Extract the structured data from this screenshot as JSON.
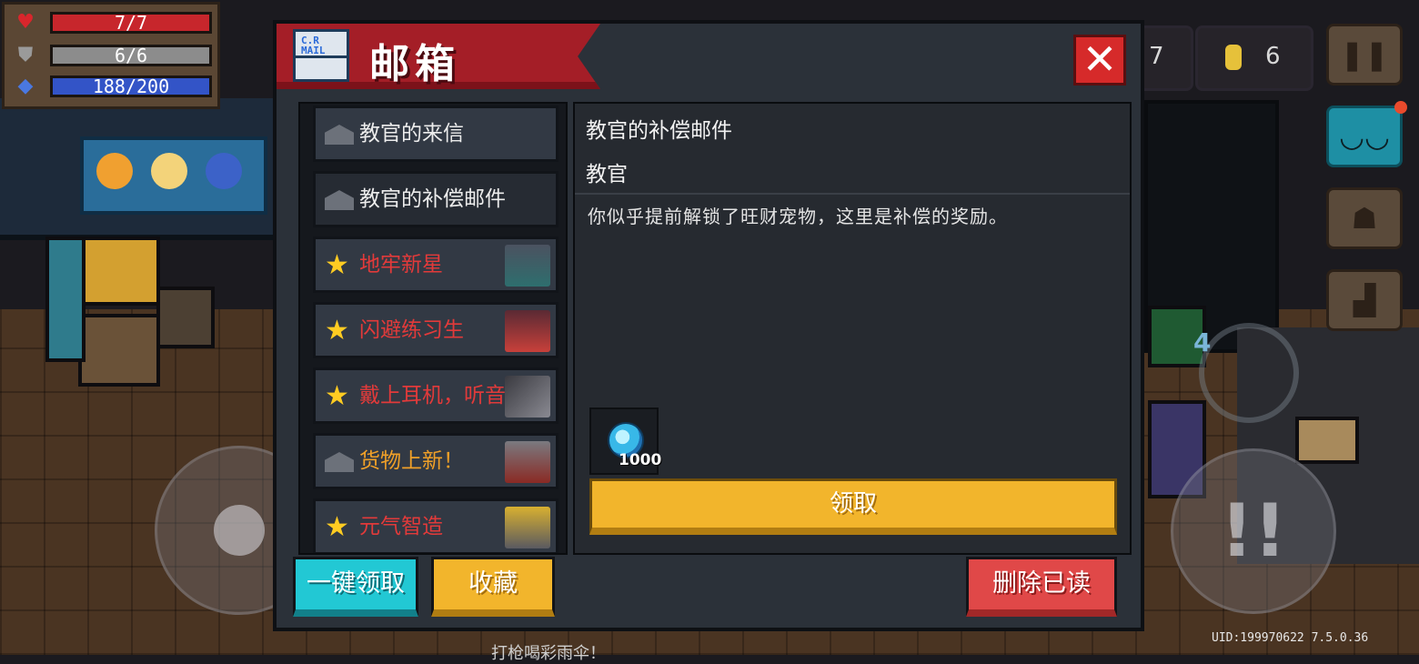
{
  "hud": {
    "hp": "7/7",
    "armor": "6/6",
    "energy": "188/200",
    "hp_value": 7,
    "hp_max": 7,
    "armor_value": 6,
    "armor_max": 6,
    "energy_value": 188,
    "energy_max": 200,
    "gem_count_partial": "7",
    "coin_count": "6"
  },
  "mailbox": {
    "title": "邮箱",
    "mail_icon_text": "C.R MAIL",
    "close_symbol": "✕",
    "items": [
      {
        "label": "教官的来信",
        "icon": "envelope-icon",
        "color": "white"
      },
      {
        "label": "教官的补偿邮件",
        "icon": "envelope-icon",
        "color": "white",
        "selected": true
      },
      {
        "label": "地牢新星",
        "icon": "star-icon",
        "color": "red"
      },
      {
        "label": "闪避练习生",
        "icon": "star-icon",
        "color": "red"
      },
      {
        "label": "戴上耳机，听音",
        "icon": "star-icon",
        "color": "red"
      },
      {
        "label": "货物上新！",
        "icon": "envelope-icon",
        "color": "orange"
      },
      {
        "label": "元气智造",
        "icon": "star-icon",
        "color": "red"
      }
    ],
    "selected_mail": {
      "title": "教官的补偿邮件",
      "sender": "教官",
      "body": "你似乎提前解锁了旺财宠物，这里是补偿的奖励。",
      "reward": {
        "icon": "gem-icon",
        "quantity": "1000"
      },
      "claim_label": "领取"
    },
    "buttons": {
      "claim_all": "一键领取",
      "favorite": "收藏",
      "delete_read": "删除已读"
    }
  },
  "footer": {
    "uid": "UID:199970622 7.5.0.36",
    "bottom_text": "打枪喝彩雨伞！"
  },
  "colors": {
    "banner": "#a41e27",
    "claim_yellow": "#f2b52c",
    "cyan_button": "#22c8d4",
    "delete_red": "#e04848",
    "star": "#ffcc22"
  }
}
